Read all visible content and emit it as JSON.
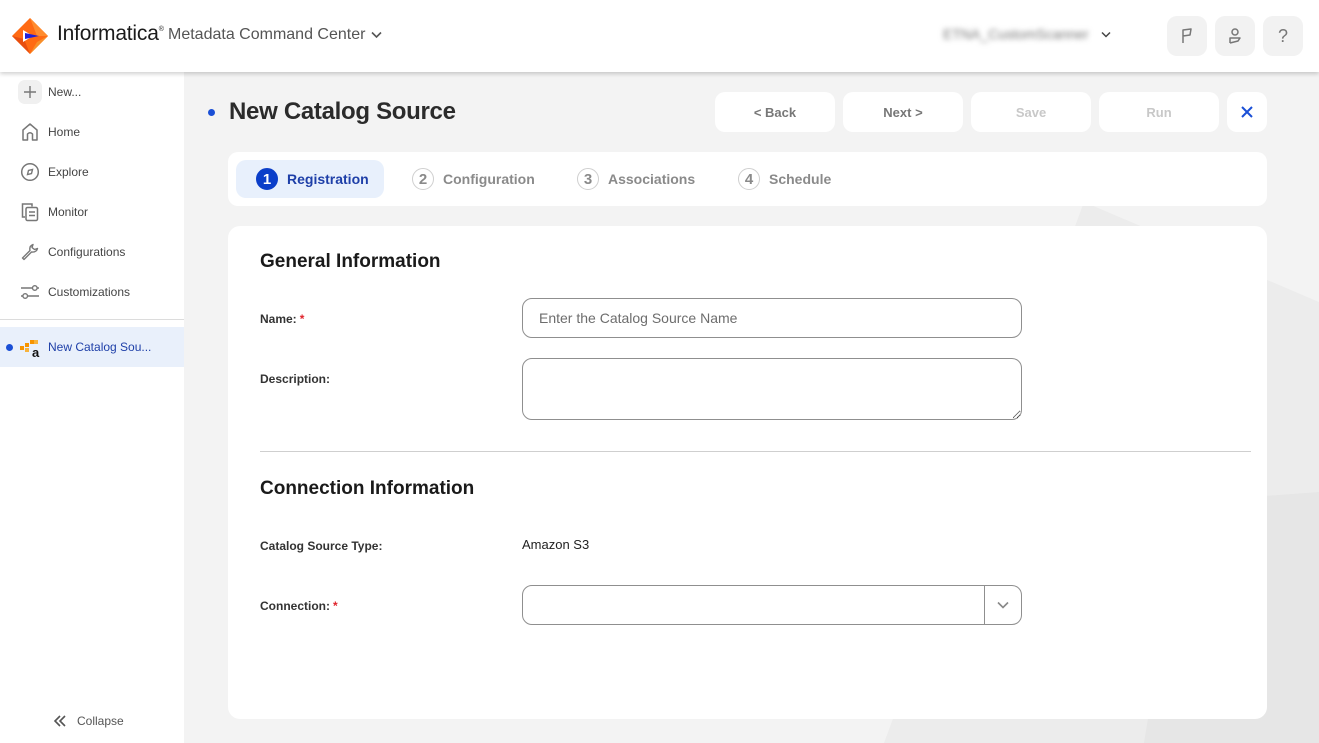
{
  "header": {
    "brand": "Informatica",
    "app_name": "Metadata Command Center",
    "org_name": "ETNA_CustomScanner",
    "icons": {
      "logo": "informatica-logo",
      "app_switch": "chevron-down-icon",
      "org_switch": "chevron-down-icon",
      "notifications": "flag-icon",
      "user": "user-icon",
      "help": "help-icon"
    },
    "help_glyph": "?"
  },
  "sidebar": {
    "items": [
      {
        "label": "New...",
        "icon": "plus-icon"
      },
      {
        "label": "Home",
        "icon": "home-icon"
      },
      {
        "label": "Explore",
        "icon": "compass-icon"
      },
      {
        "label": "Monitor",
        "icon": "monitor-docs-icon"
      },
      {
        "label": "Configurations",
        "icon": "wrench-icon"
      },
      {
        "label": "Customizations",
        "icon": "sliders-icon"
      }
    ],
    "open_tabs": [
      {
        "label": "New Catalog Sou...",
        "icon": "amazon-aws-icon",
        "unsaved": true
      }
    ],
    "collapse_label": "Collapse"
  },
  "page": {
    "title": "New Catalog Source",
    "actions": {
      "back": "< Back",
      "next": "Next >",
      "save": "Save",
      "run": "Run"
    },
    "steps": [
      {
        "num": "1",
        "label": "Registration",
        "active": true
      },
      {
        "num": "2",
        "label": "Configuration",
        "active": false
      },
      {
        "num": "3",
        "label": "Associations",
        "active": false
      },
      {
        "num": "4",
        "label": "Schedule",
        "active": false
      }
    ]
  },
  "form": {
    "general": {
      "title": "General Information",
      "name_label": "Name:",
      "name_required": "*",
      "name_value": "",
      "name_placeholder": "Enter the Catalog Source Name",
      "description_label": "Description:",
      "description_value": ""
    },
    "connection": {
      "title": "Connection Information",
      "source_type_label": "Catalog Source Type:",
      "source_type_value": "Amazon S3",
      "connection_label": "Connection:",
      "connection_required": "*",
      "connection_value": ""
    }
  },
  "colors": {
    "accent": "#1a4fd6",
    "active_step_bg": "#e8f0fc",
    "required": "#e0242c",
    "disabled_text": "#c8c8c8"
  }
}
